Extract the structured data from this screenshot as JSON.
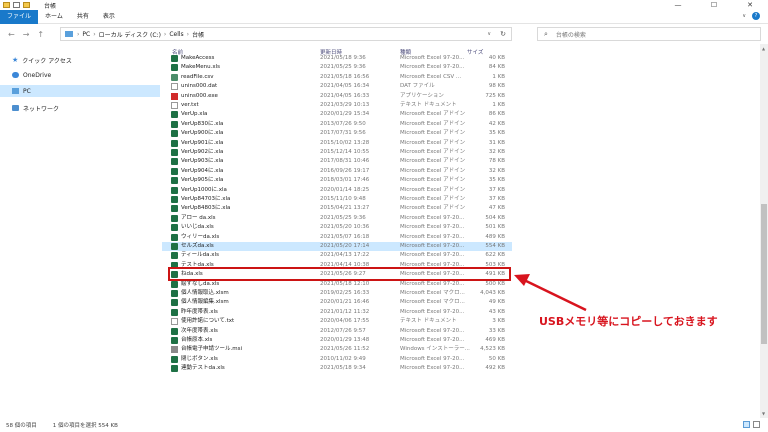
{
  "window": {
    "title": "台帳",
    "controls": [
      "—",
      "☐",
      "✕"
    ]
  },
  "ribbon": {
    "tabs": [
      "ファイル",
      "ホーム",
      "共有",
      "表示"
    ],
    "help": "?"
  },
  "address": {
    "crumbs": [
      "PC",
      "ローカル ディスク (C:)",
      "Cells",
      "台帳"
    ],
    "search_placeholder": "台帳の検索"
  },
  "nav_pane": {
    "items": [
      {
        "label": "クイック アクセス",
        "icon": "star-icon"
      },
      {
        "label": "OneDrive",
        "icon": "cloud-icon"
      },
      {
        "label": "PC",
        "icon": "pc-icon",
        "selected": true
      },
      {
        "label": "ネットワーク",
        "icon": "network-icon"
      }
    ]
  },
  "file_list": {
    "headers": {
      "name": "名前",
      "date": "更新日時",
      "type": "種類",
      "size": "サイズ"
    },
    "rows": [
      {
        "name": "MakeAccess",
        "date": "2021/05/18 9:36",
        "type": "Microsoft Excel 97-20...",
        "size": "40 KB",
        "icon": "xl"
      },
      {
        "name": "MakeMenu.xls",
        "date": "2021/05/25 9:36",
        "type": "Microsoft Excel 97-20...",
        "size": "84 KB",
        "icon": "xl"
      },
      {
        "name": "readFile.csv",
        "date": "2021/05/18 16:56",
        "type": "Microsoft Excel CSV ...",
        "size": "1 KB",
        "icon": "csv"
      },
      {
        "name": "unins000.dat",
        "date": "2021/04/05 16:34",
        "type": "DAT ファイル",
        "size": "98 KB",
        "icon": "txt"
      },
      {
        "name": "unins000.exe",
        "date": "2021/04/05 16:33",
        "type": "アプリケーション",
        "size": "725 KB",
        "icon": "exe"
      },
      {
        "name": "ver.txt",
        "date": "2021/03/29 10:13",
        "type": "テキスト ドキュメント",
        "size": "1 KB",
        "icon": "txt"
      },
      {
        "name": "VerUp.xla",
        "date": "2020/01/29 15:34",
        "type": "Microsoft Excel アドイン",
        "size": "86 KB",
        "icon": "xl"
      },
      {
        "name": "VerUp830に.xla",
        "date": "2013/07/26 9:50",
        "type": "Microsoft Excel アドイン",
        "size": "42 KB",
        "icon": "xl"
      },
      {
        "name": "VerUp900に.xla",
        "date": "2017/07/31 9:56",
        "type": "Microsoft Excel アドイン",
        "size": "35 KB",
        "icon": "xl"
      },
      {
        "name": "VerUp901に.xla",
        "date": "2015/10/02 13:28",
        "type": "Microsoft Excel アドイン",
        "size": "31 KB",
        "icon": "xl"
      },
      {
        "name": "VerUp902に.xla",
        "date": "2015/12/14 10:55",
        "type": "Microsoft Excel アドイン",
        "size": "32 KB",
        "icon": "xl"
      },
      {
        "name": "VerUp903に.xla",
        "date": "2017/08/31 10:46",
        "type": "Microsoft Excel アドイン",
        "size": "78 KB",
        "icon": "xl"
      },
      {
        "name": "VerUp904に.xla",
        "date": "2016/09/26 19:17",
        "type": "Microsoft Excel アドイン",
        "size": "32 KB",
        "icon": "xl"
      },
      {
        "name": "VerUp905に.xla",
        "date": "2018/03/01 17:46",
        "type": "Microsoft Excel アドイン",
        "size": "35 KB",
        "icon": "xl"
      },
      {
        "name": "VerUp1000に.xla",
        "date": "2020/01/14 18:25",
        "type": "Microsoft Excel アドイン",
        "size": "37 KB",
        "icon": "xl"
      },
      {
        "name": "VerUp84703に.xla",
        "date": "2015/11/10 9:48",
        "type": "Microsoft Excel アドイン",
        "size": "37 KB",
        "icon": "xl"
      },
      {
        "name": "VerUp84803に.xla",
        "date": "2015/04/21 13:27",
        "type": "Microsoft Excel アドイン",
        "size": "47 KB",
        "icon": "xl"
      },
      {
        "name": "アロー da.xls",
        "date": "2021/05/25 9:36",
        "type": "Microsoft Excel 97-20...",
        "size": "504 KB",
        "icon": "xl"
      },
      {
        "name": "いいじda.xls",
        "date": "2021/05/20 10:36",
        "type": "Microsoft Excel 97-20...",
        "size": "501 KB",
        "icon": "xl"
      },
      {
        "name": "ウィリーda.xls",
        "date": "2021/05/07 16:18",
        "type": "Microsoft Excel 97-20...",
        "size": "489 KB",
        "icon": "xl"
      },
      {
        "name": "セルズda.xls",
        "date": "2021/05/20 17:14",
        "type": "Microsoft Excel 97-20...",
        "size": "554 KB",
        "icon": "xl",
        "selected": true
      },
      {
        "name": "ティールda.xls",
        "date": "2021/04/13 17:22",
        "type": "Microsoft Excel 97-20...",
        "size": "622 KB",
        "icon": "xl"
      },
      {
        "name": "テストda.xls",
        "date": "2021/04/14 10:38",
        "type": "Microsoft Excel 97-20...",
        "size": "503 KB",
        "icon": "xl"
      },
      {
        "name": "ねda.xls",
        "date": "2021/05/26 9:27",
        "type": "Microsoft Excel 97-20...",
        "size": "491 KB",
        "icon": "xl"
      },
      {
        "name": "絵ずなしda.xls",
        "date": "2021/05/18 12:10",
        "type": "Microsoft Excel 97-20...",
        "size": "500 KB",
        "icon": "xl"
      },
      {
        "name": "個人情報取込.xlsm",
        "date": "2019/02/25 16:33",
        "type": "Microsoft Excel マクロ...",
        "size": "4,043 KB",
        "icon": "xl"
      },
      {
        "name": "個人情報編集.xlsm",
        "date": "2020/01/21 16:46",
        "type": "Microsoft Excel マクロ...",
        "size": "49 KB",
        "icon": "xl"
      },
      {
        "name": "昨年度帯表.xls",
        "date": "2021/01/12 11:32",
        "type": "Microsoft Excel 97-20...",
        "size": "43 KB",
        "icon": "xl"
      },
      {
        "name": "使用許諾について.txt",
        "date": "2020/04/06 17:55",
        "type": "テキスト ドキュメント",
        "size": "3 KB",
        "icon": "txt"
      },
      {
        "name": "次年度帯表.xls",
        "date": "2012/07/26 9:57",
        "type": "Microsoft Excel 97-20...",
        "size": "33 KB",
        "icon": "xl"
      },
      {
        "name": "台帳原本.xls",
        "date": "2020/01/29 13:48",
        "type": "Microsoft Excel 97-20...",
        "size": "469 KB",
        "icon": "xl"
      },
      {
        "name": "台帳電子申請ツール.msi",
        "date": "2021/05/26 11:52",
        "type": "Windows インストーラー...",
        "size": "4,523 KB",
        "icon": "msi"
      },
      {
        "name": "閉じボタン.xls",
        "date": "2010/11/02 9:49",
        "type": "Microsoft Excel 97-20...",
        "size": "50 KB",
        "icon": "xl"
      },
      {
        "name": "連動テストda.xls",
        "date": "2021/05/18 9:34",
        "type": "Microsoft Excel 97-20...",
        "size": "492 KB",
        "icon": "xl"
      }
    ]
  },
  "annotation": {
    "text": "USBメモリ等にコピーしておきます",
    "color": "#d8141e"
  },
  "status": {
    "count": "58 個の項目",
    "selection": "1 個の項目を選択  554 KB"
  }
}
